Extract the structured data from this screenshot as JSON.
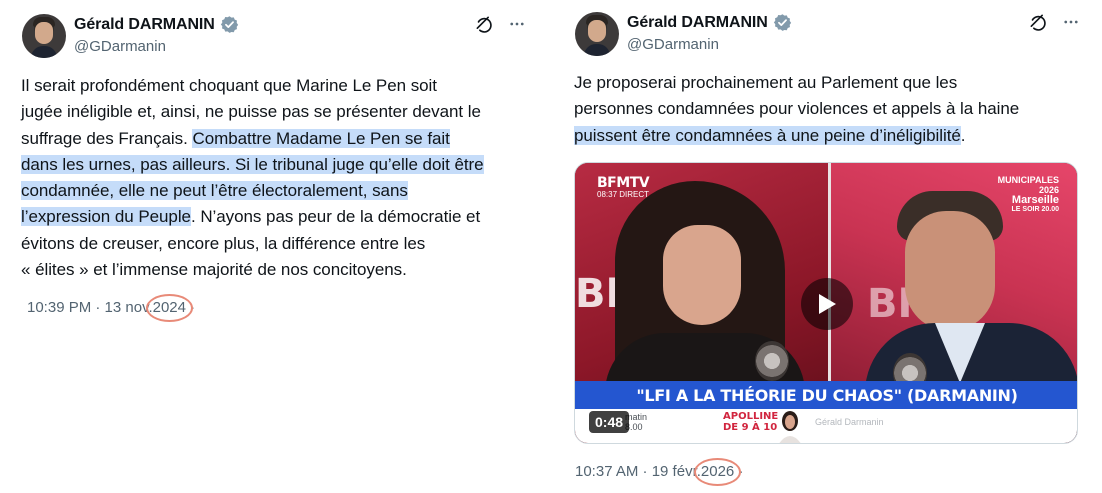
{
  "tweets": [
    {
      "author": {
        "name": "Gérald DARMANIN",
        "handle": "@GDarmanin"
      },
      "text_parts": [
        {
          "text": "Il serait profondément choquant que Marine Le Pen soit jugée inéligible et, ainsi, ne puisse pas se présenter devant le suffrage des Français. ",
          "highlighted": false
        },
        {
          "text": "Combattre Madame Le Pen se fait dans les urnes, pas ailleurs. Si le tribunal juge qu’elle doit être condamnée, elle ne peut l’être électoralement, sans l’expression du Peuple",
          "highlighted": true
        },
        {
          "text": ". N’ayons pas peur de la démocratie et évitons de creuser, encore plus, la différence entre les « élites » et l’immense majorité de nos concitoyens.",
          "highlighted": false
        }
      ],
      "lines": [
        [
          {
            "t": "Il serait profondément choquant que Marine Le Pen soit",
            "h": false
          }
        ],
        [
          {
            "t": "jugée inéligible et, ainsi, ne puisse pas se présenter devant le",
            "h": false
          }
        ],
        [
          {
            "t": "suffrage des Français. ",
            "h": false
          },
          {
            "t": "Combattre Madame Le Pen se fait",
            "h": true
          }
        ],
        [
          {
            "t": "dans les urnes, pas ailleurs. Si le tribunal juge qu’elle doit être",
            "h": true
          }
        ],
        [
          {
            "t": "condamnée, elle ne peut l’être électoralement, sans",
            "h": true
          }
        ],
        [
          {
            "t": "l’expression du Peuple",
            "h": true
          },
          {
            "t": ". N’ayons pas peur de la démocratie et",
            "h": false
          }
        ],
        [
          {
            "t": "évitons de creuser, encore plus, la différence entre les",
            "h": false
          }
        ],
        [
          {
            "t": "« élites » et l’immense majorité de nos concitoyens.",
            "h": false
          }
        ]
      ],
      "timestamp_prefix": "10:39 PM · 13 nov.",
      "timestamp_year": "2024",
      "timestamp_suffix": "·"
    },
    {
      "author": {
        "name": "Gérald DARMANIN",
        "handle": "@GDarmanin"
      },
      "lines": [
        [
          {
            "t": "Je proposerai prochainement au Parlement que les",
            "h": false
          }
        ],
        [
          {
            "t": "personnes condamnées pour violences et appels à la haine",
            "h": false
          }
        ],
        [
          {
            "t": "puissent être condamnées à une peine d’inéligibilité",
            "h": true
          },
          {
            "t": ".",
            "h": false
          }
        ]
      ],
      "video": {
        "channel_logo": "BFMTV",
        "channel_time": "08:37  DIRECT",
        "badge_line1": "MUNICIPALES",
        "badge_line2": "2026",
        "badge_city": "Marseille",
        "badge_sub": "LE SOIR 20.00",
        "background_text": "BFM",
        "banner": "\"LFI A LA THÉORIE DU CHAOS\" (DARMANIN)",
        "lower_small": "matin\n8.00",
        "lower_red": "APOLLINE\nDE 9 À 10",
        "lower_grey": "Gérald Darmanin",
        "duration": "0:48"
      },
      "timestamp_prefix": "10:37 AM · 19 févr.",
      "timestamp_year": "2026",
      "timestamp_suffix": "·"
    }
  ],
  "colors": {
    "verified_badge": "#829aab",
    "highlight": "#c5dcf9",
    "secondary_text": "#536471",
    "annotation_circle": "#e88a78",
    "banner_blue": "#2456d0"
  },
  "icons": [
    "verified-badge-icon",
    "grok-icon",
    "more-options-icon",
    "play-icon"
  ]
}
